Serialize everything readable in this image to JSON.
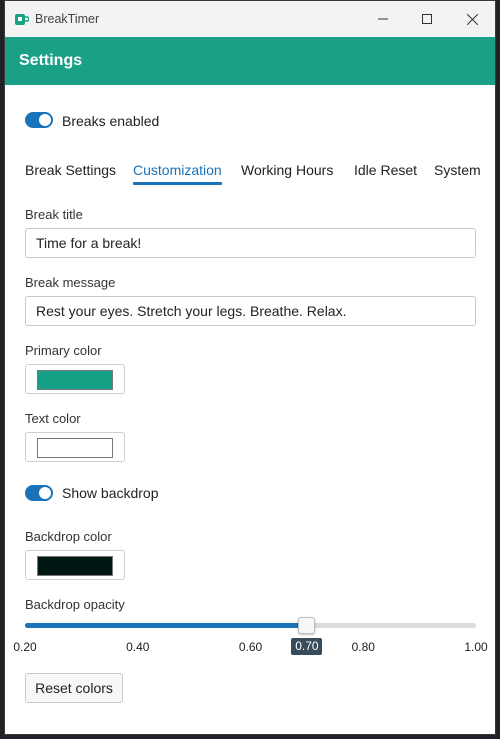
{
  "window": {
    "title": "BreakTimer",
    "accent_color": "#1aa085"
  },
  "header": {
    "title": "Settings"
  },
  "breaks_toggle": {
    "label": "Breaks enabled",
    "checked": true
  },
  "tabs": [
    {
      "label": "Break Settings",
      "active": false
    },
    {
      "label": "Customization",
      "active": true
    },
    {
      "label": "Working Hours",
      "active": false
    },
    {
      "label": "Idle Reset",
      "active": false
    },
    {
      "label": "System",
      "active": false
    }
  ],
  "break_title": {
    "label": "Break title",
    "value": "Time for a break!"
  },
  "break_message": {
    "label": "Break message",
    "value": "Rest your eyes. Stretch your legs. Breathe. Relax."
  },
  "primary_color": {
    "label": "Primary color",
    "value": "#16a085"
  },
  "text_color": {
    "label": "Text color",
    "value": "#ffffff"
  },
  "backdrop_toggle": {
    "label": "Show backdrop",
    "checked": true
  },
  "backdrop_color": {
    "label": "Backdrop color",
    "value": "#001714"
  },
  "backdrop_opacity": {
    "label": "Backdrop opacity",
    "value": 0.7,
    "value_label": "0.70",
    "min": 0.2,
    "max": 1.0,
    "ticks": [
      "0.20",
      "0.40",
      "0.60",
      "0.80",
      "1.00"
    ]
  },
  "reset_button": {
    "label": "Reset colors"
  }
}
